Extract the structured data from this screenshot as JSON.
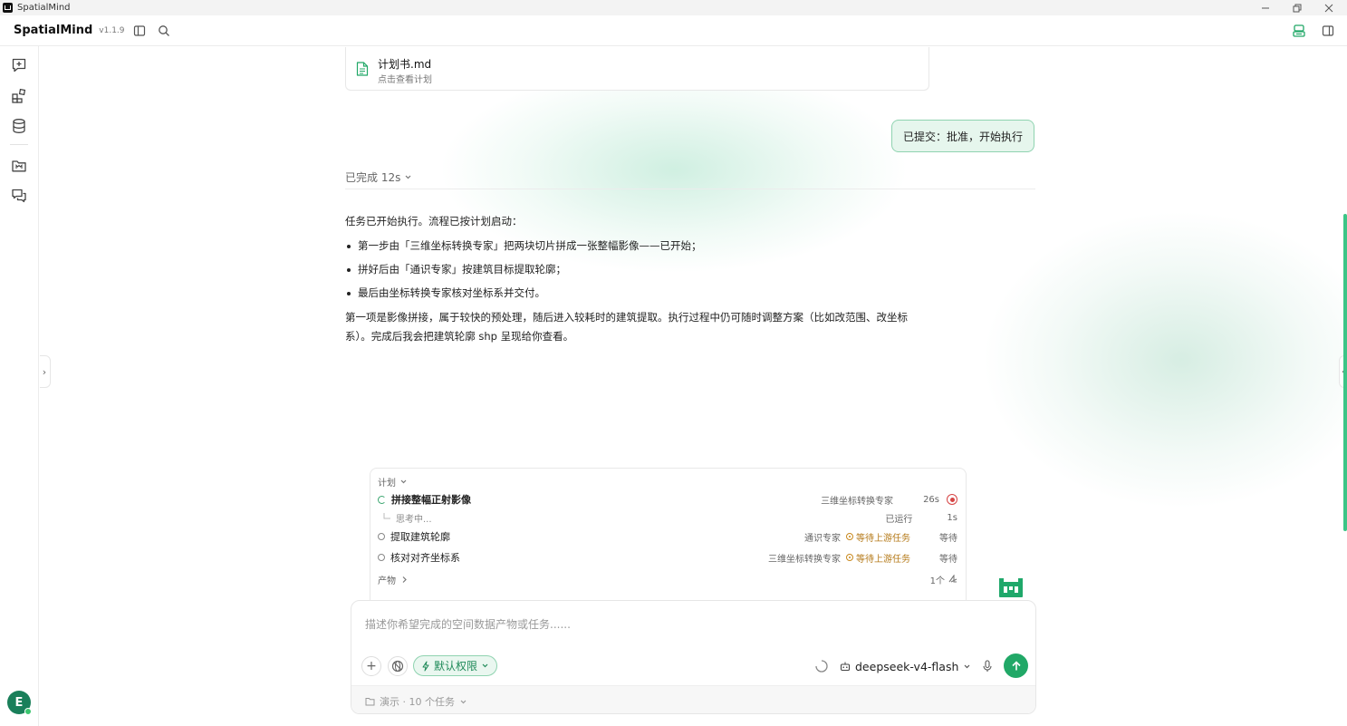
{
  "window": {
    "title": "SpatialMind"
  },
  "header": {
    "brand": "SpatialMind",
    "version": "v1.1.9"
  },
  "file_card": {
    "name": "计划书.md",
    "subtitle": "点击查看计划"
  },
  "user_message": "已提交：批准，开始执行",
  "status": {
    "label": "已完成 12s"
  },
  "answer": {
    "intro": "任务已开始执行。流程已按计划启动：",
    "bullets": [
      "第一步由「三维坐标转换专家」把两块切片拼成一张整幅影像——已开始；",
      "拼好后由「通识专家」按建筑目标提取轮廓；",
      "最后由坐标转换专家核对坐标系并交付。"
    ],
    "closing": "第一项是影像拼接，属于较快的预处理，随后进入较耗时的建筑提取。执行过程中仍可随时调整方案（比如改范围、改坐标系）。完成后我会把建筑轮廓 shp 呈现给你查看。"
  },
  "plan": {
    "header": "计划",
    "tasks": [
      {
        "name": "拼接整幅正射影像",
        "agent": "三维坐标转换专家",
        "time": "26s",
        "state": "running"
      },
      {
        "name": "提取建筑轮廓",
        "agent": "通识专家",
        "badge": "等待上游任务",
        "status": "等待",
        "state": "pending"
      },
      {
        "name": "核对对齐坐标系",
        "agent": "三维坐标转换专家",
        "badge": "等待上游任务",
        "status": "等待",
        "state": "pending"
      }
    ],
    "thinking": {
      "label": "思考中...",
      "status": "已运行",
      "time": "1s"
    },
    "products": {
      "label": "产物",
      "count": "1个"
    }
  },
  "composer": {
    "placeholder": "描述你希望完成的空间数据产物或任务......",
    "permission": "默认权限",
    "model": "deepseek-v4-flash",
    "workspace": "演示 · 10 个任务"
  },
  "user": {
    "avatar_letter": "E"
  },
  "colors": {
    "accent": "#21a867",
    "wait": "#b57a19",
    "stop": "#d64545"
  }
}
